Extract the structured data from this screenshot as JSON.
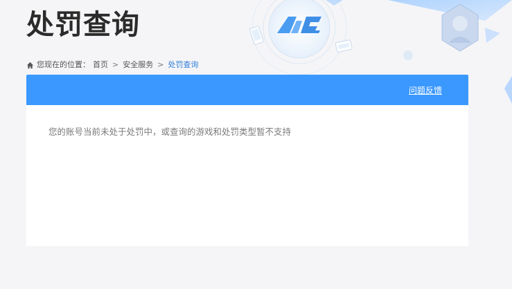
{
  "header": {
    "title": "处罚查询",
    "logo_text": "ACE"
  },
  "breadcrumb": {
    "prefix": "您现在的位置：",
    "items": [
      "首页",
      "安全服务",
      "处罚查询"
    ],
    "separator": ">"
  },
  "panel": {
    "feedback_label": "问题反馈",
    "message": "您的账号当前未处于处罚中，或查询的游戏和处罚类型暂不支持"
  },
  "colors": {
    "accent": "#3a98ff",
    "breadcrumb_current": "#2f7fd8",
    "title": "#2b2b2b"
  },
  "icons": [
    "home-icon",
    "ace-logo-icon",
    "phone-icon",
    "game-card-icon",
    "character-badge-icon"
  ]
}
